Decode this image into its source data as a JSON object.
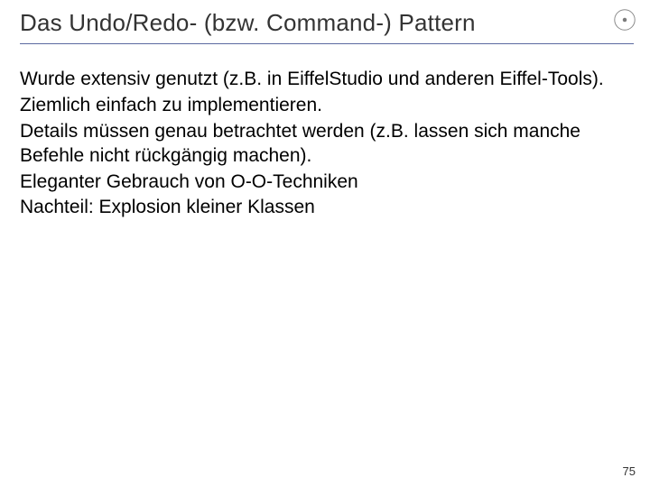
{
  "title": "Das Undo/Redo- (bzw. Command-) Pattern",
  "body": {
    "p1": "Wurde extensiv genutzt  (z.B. in EiffelStudio und anderen Eiffel-Tools).",
    "p2": "Ziemlich einfach zu implementieren.",
    "p3": "Details müssen genau betrachtet werden (z.B. lassen sich manche Befehle nicht rückgängig machen).",
    "p4": "Eleganter Gebrauch von O-O-Techniken",
    "p5": "Nachteil: Explosion kleiner Klassen"
  },
  "page_number": "75"
}
